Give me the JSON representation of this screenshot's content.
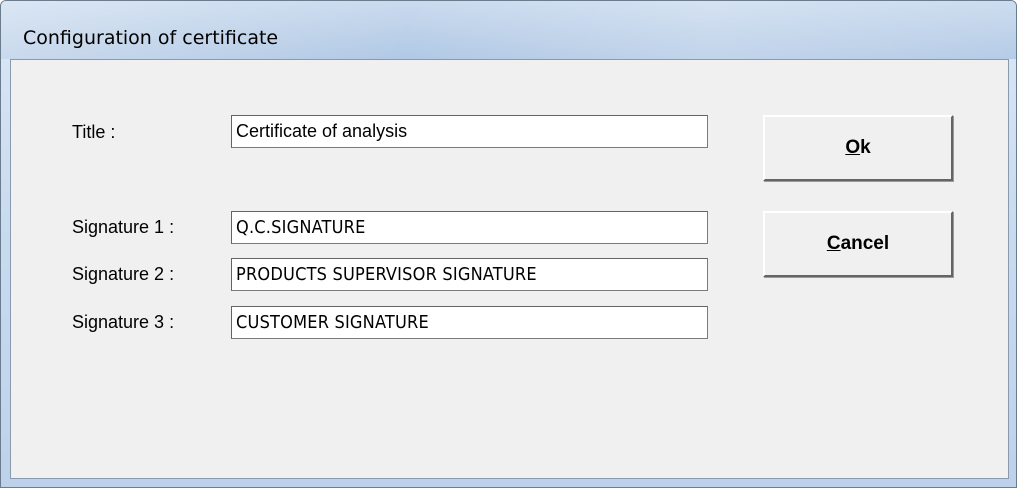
{
  "window": {
    "title": "Configuration of certificate"
  },
  "form": {
    "title_label": "Title :",
    "title_value": "Certificate of analysis",
    "signature1_label": "Signature 1 :",
    "signature1_value": "Q.C.SIGNATURE",
    "signature2_label": "Signature 2 :",
    "signature2_value": "PRODUCTS SUPERVISOR SIGNATURE",
    "signature3_label": "Signature 3 :",
    "signature3_value": "CUSTOMER SIGNATURE"
  },
  "buttons": {
    "ok_mnemonic": "O",
    "ok_rest": "k",
    "cancel_mnemonic": "C",
    "cancel_rest": "ancel"
  }
}
